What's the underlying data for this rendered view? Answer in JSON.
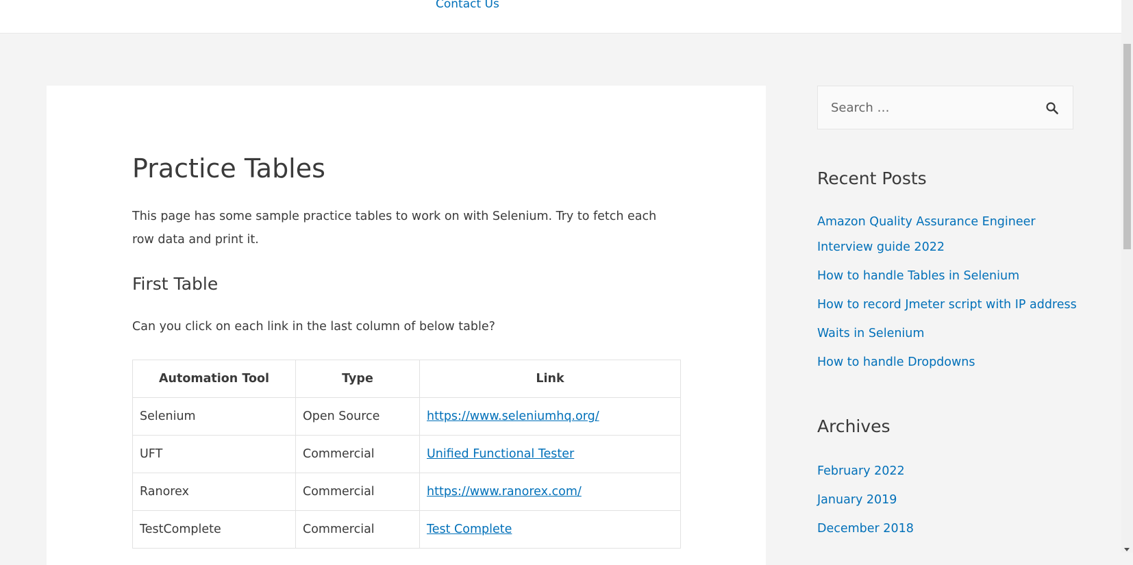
{
  "nav": {
    "contact_label": "Contact Us"
  },
  "page": {
    "title": "Practice Tables",
    "intro": "This page has some sample practice tables to work on with Selenium. Try to fetch each row data and print it.",
    "section_title": "First Table",
    "question": "Can you click on each link in the last column of below table?"
  },
  "table": {
    "headers": [
      "Automation Tool",
      "Type",
      "Link"
    ],
    "rows": [
      [
        "Selenium",
        "Open Source",
        "https://www.seleniumhq.org/"
      ],
      [
        "UFT",
        "Commercial",
        "Unified Functional Tester"
      ],
      [
        "Ranorex",
        "Commercial",
        "https://www.ranorex.com/"
      ],
      [
        "TestComplete",
        "Commercial",
        "Test Complete"
      ]
    ]
  },
  "sidebar": {
    "search": {
      "placeholder": "Search …",
      "icon": "search-icon"
    },
    "recent_posts": {
      "title": "Recent Posts",
      "items": [
        "Amazon Quality Assurance Engineer Interview guide 2022",
        "How to handle Tables in Selenium",
        "How to record Jmeter script with IP address",
        "Waits in Selenium",
        "How to handle Dropdowns"
      ]
    },
    "archives": {
      "title": "Archives",
      "items": [
        "February 2022",
        "January 2019",
        "December 2018"
      ]
    }
  },
  "colors": {
    "link": "#0170b9",
    "text": "#3a3a3a",
    "background": "#f4f4f4"
  }
}
